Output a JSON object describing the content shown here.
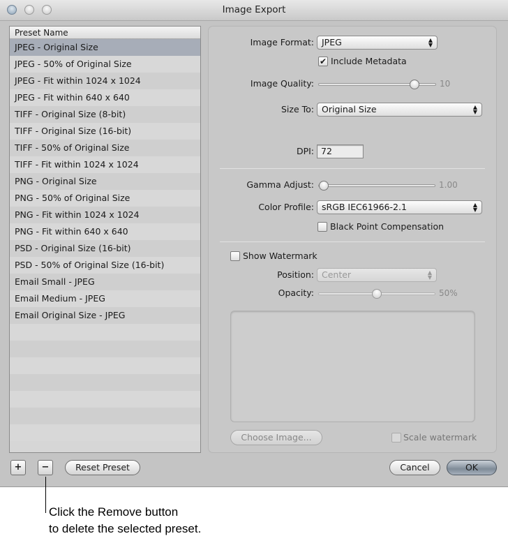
{
  "window": {
    "title": "Image Export"
  },
  "preset_list": {
    "header": "Preset Name",
    "selected_index": 0,
    "items": [
      "JPEG - Original Size",
      "JPEG - 50% of Original Size",
      "JPEG - Fit within 1024 x 1024",
      "JPEG - Fit within 640 x 640",
      "TIFF - Original Size (8-bit)",
      "TIFF - Original Size (16-bit)",
      "TIFF - 50% of Original Size",
      "TIFF - Fit within 1024 x 1024",
      "PNG - Original Size",
      "PNG - 50% of Original Size",
      "PNG - Fit within 1024 x 1024",
      "PNG - Fit within 640 x 640",
      "PSD - Original Size (16-bit)",
      "PSD - 50% of Original Size (16-bit)",
      "Email Small - JPEG",
      "Email Medium - JPEG",
      "Email Original Size - JPEG"
    ]
  },
  "settings": {
    "image_format": {
      "label": "Image Format:",
      "value": "JPEG"
    },
    "include_metadata": {
      "label": "Include Metadata",
      "checked": true,
      "check_glyph": "✔"
    },
    "image_quality": {
      "label": "Image Quality:",
      "value": "10",
      "fraction": 0.82
    },
    "size_to": {
      "label": "Size To:",
      "value": "Original Size"
    },
    "dpi": {
      "label": "DPI:",
      "value": "72"
    },
    "gamma": {
      "label": "Gamma Adjust:",
      "value": "1.00",
      "fraction": 0.0
    },
    "color_profile": {
      "label": "Color Profile:",
      "value": "sRGB IEC61966-2.1"
    },
    "black_point": {
      "label": "Black Point Compensation",
      "checked": false
    },
    "show_watermark": {
      "label": "Show Watermark",
      "checked": false
    },
    "position": {
      "label": "Position:",
      "value": "Center"
    },
    "opacity": {
      "label": "Opacity:",
      "value": "50%",
      "fraction": 0.5
    },
    "choose_image": "Choose Image...",
    "scale_watermark": {
      "label": "Scale watermark",
      "checked": false
    }
  },
  "footer": {
    "add": "+",
    "remove": "−",
    "reset": "Reset Preset",
    "cancel": "Cancel",
    "ok": "OK"
  },
  "callout": {
    "line1": "Click the Remove button",
    "line2": "to delete the selected preset."
  }
}
